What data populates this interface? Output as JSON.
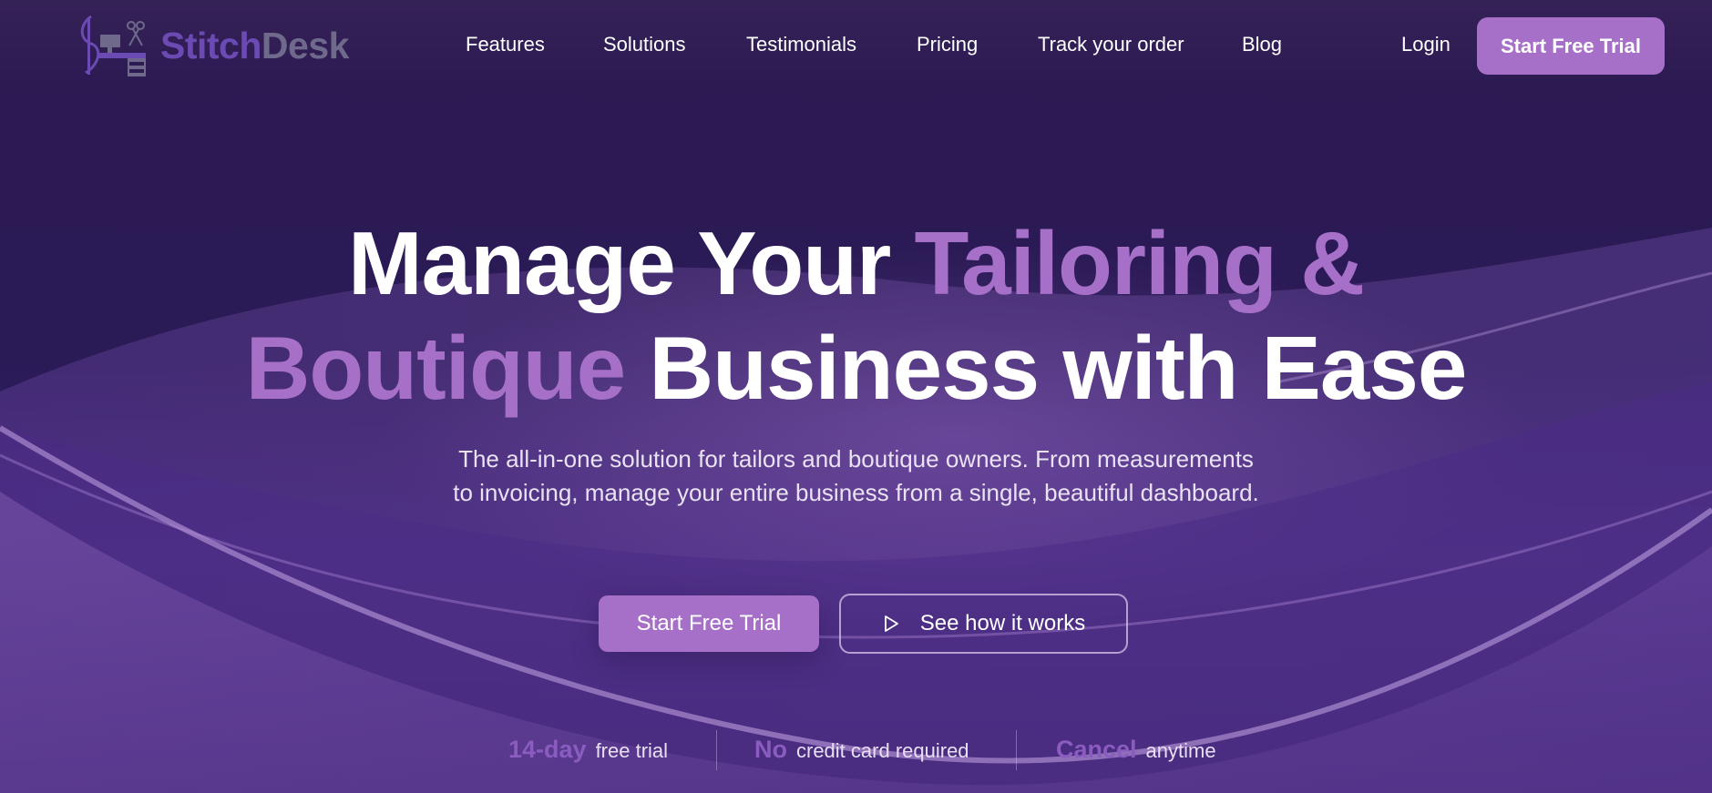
{
  "brand": {
    "name_part1": "Stitch",
    "name_part2": "Desk"
  },
  "nav": {
    "items": [
      {
        "label": "Features"
      },
      {
        "label": "Solutions"
      },
      {
        "label": "Testimonials"
      },
      {
        "label": "Pricing"
      },
      {
        "label": "Track your order"
      },
      {
        "label": "Blog"
      }
    ],
    "login_label": "Login",
    "cta_label": "Start Free Trial"
  },
  "hero": {
    "title_line1_white": "Manage Your ",
    "title_line1_accent": "Tailoring &",
    "title_line2_accent": "Boutique",
    "title_line2_white": " Business with Ease",
    "subtitle": "The all-in-one solution for tailors and boutique owners. From measurements to invoicing, manage your entire business from a single, beautiful dashboard.",
    "primary_cta": "Start Free Trial",
    "secondary_cta": "See how it works"
  },
  "trust": [
    {
      "strong": "14-day",
      "text": "free trial"
    },
    {
      "strong": "No",
      "text": "credit card required"
    },
    {
      "strong": "Cancel",
      "text": "anytime"
    }
  ],
  "colors": {
    "accent": "#a66fc8",
    "background": "#2a1850",
    "logo_primary": "#6b4bb3",
    "logo_secondary": "#6f6a8c"
  },
  "icons": {
    "logo": "sewing-desk-icon",
    "secondary_cta": "play-icon"
  }
}
